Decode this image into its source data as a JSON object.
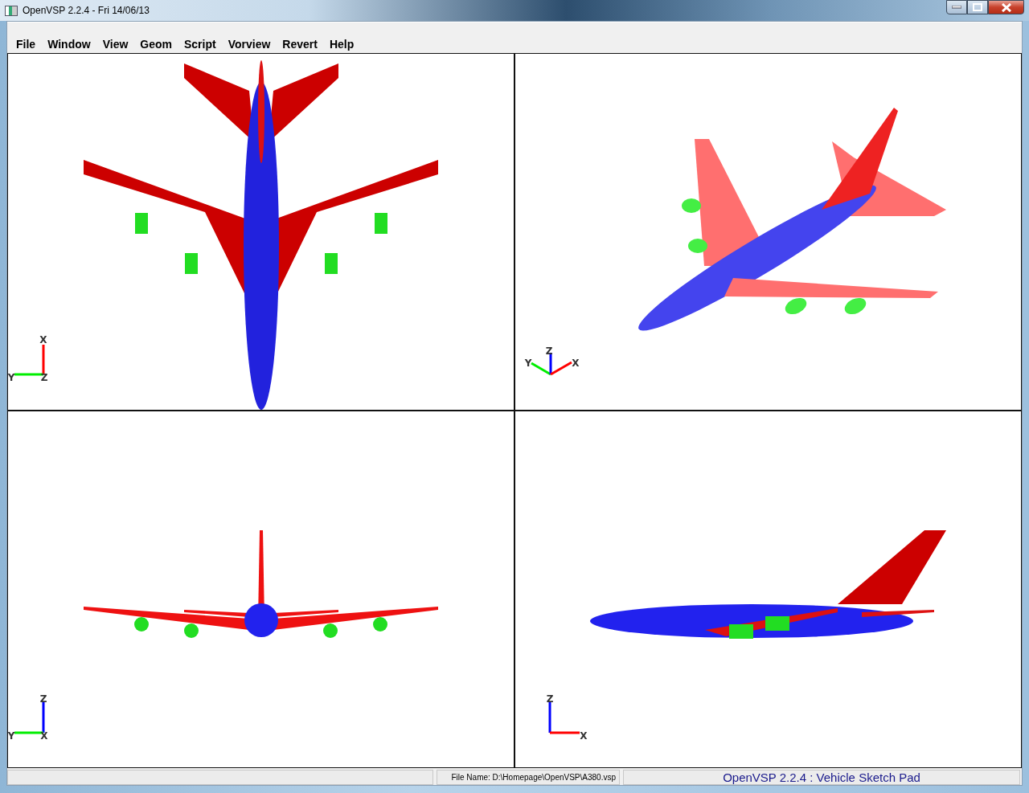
{
  "window": {
    "title": "OpenVSP 2.2.4 - Fri 14/06/13"
  },
  "menu": [
    {
      "label": "File"
    },
    {
      "label": "Window"
    },
    {
      "label": "View"
    },
    {
      "label": "Geom"
    },
    {
      "label": "Script"
    },
    {
      "label": "Vorview"
    },
    {
      "label": "Revert"
    },
    {
      "label": "Help"
    }
  ],
  "viewports": [
    {
      "kind": "top",
      "axes": [
        {
          "kind": "x",
          "label": "X"
        },
        {
          "kind": "y",
          "label": "Y"
        },
        {
          "kind": "z",
          "label": "Z"
        }
      ]
    },
    {
      "kind": "iso",
      "axes": [
        {
          "kind": "y",
          "label": "Y"
        },
        {
          "kind": "z",
          "label": "Z"
        },
        {
          "kind": "x",
          "label": "X"
        }
      ]
    },
    {
      "kind": "front",
      "axes": [
        {
          "kind": "z",
          "label": "Z"
        },
        {
          "kind": "y",
          "label": "Y"
        },
        {
          "kind": "x",
          "label": "X"
        }
      ]
    },
    {
      "kind": "side",
      "axes": [
        {
          "kind": "z",
          "label": "Z"
        },
        {
          "kind": "x",
          "label": "X"
        }
      ]
    }
  ],
  "status_bar": {
    "file_name": "File Name: D:\\Homepage\\OpenVSP\\A380.vsp",
    "app_name": "OpenVSP 2.2.4 : Vehicle Sketch Pad"
  }
}
